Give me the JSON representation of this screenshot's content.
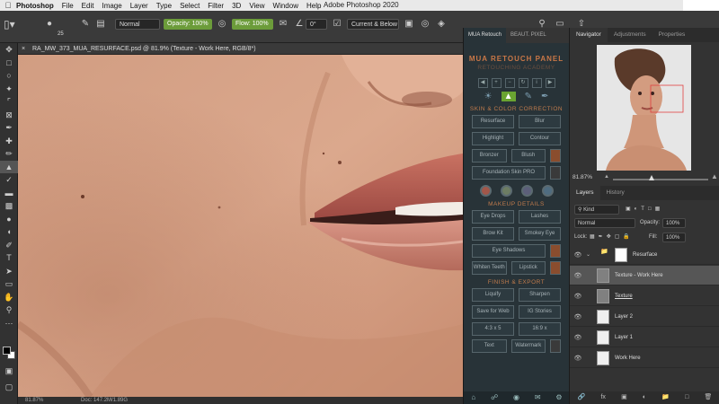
{
  "menubar": {
    "app_name": "Photoshop",
    "items": [
      "File",
      "Edit",
      "Image",
      "Layer",
      "Type",
      "Select",
      "Filter",
      "3D",
      "View",
      "Window",
      "Help"
    ],
    "window_title": "Adobe Photoshop 2020"
  },
  "options": {
    "brush_size": "25",
    "mode": "Normal",
    "opacity_label": "Opacity:",
    "opacity_value": "100%",
    "flow_label": "Flow:",
    "flow_value": "100%",
    "angle": "0°",
    "sample": "Current & Below"
  },
  "document": {
    "tab_title": "RA_MW_373_MUA_RESURFACE.psd @ 81.9% (Texture - Work Here, RGB/8*)",
    "status_zoom": "81.87%",
    "status_doc": "Doc: 147.2M/1.89G"
  },
  "mua_panel": {
    "tabs": [
      "MUA Retouch",
      "BEAUT. PIXEL"
    ],
    "title": "MUA RETOUCH PANEL",
    "subtitle": "RETOUCHING ACADEMY",
    "section_skin": "SKIN & COLOR CORRECTION",
    "skin_buttons": [
      [
        "Resurface",
        "Blur"
      ],
      [
        "Highlight",
        "Contour"
      ],
      [
        "Bronzer",
        "Blush"
      ]
    ],
    "foundation": "Foundation Skin PRO",
    "section_makeup": "MAKEUP DETAILS",
    "makeup_buttons": [
      [
        "Eye Drops",
        "Lashes"
      ],
      [
        "Brow Kit",
        "Smokey Eye"
      ]
    ],
    "eye_shadows": "Eye Shadows",
    "makeup_row3": [
      "Whiten Teeth",
      "Lipstick"
    ],
    "section_finish": "FINISH & EXPORT",
    "finish_buttons": [
      [
        "Liquify",
        "Sharpen"
      ],
      [
        "Save for Web",
        "IG Stories"
      ],
      [
        "4:3 x 5",
        "16:9 x"
      ],
      [
        "Text",
        "Watermark"
      ]
    ]
  },
  "navigator": {
    "tabs": [
      "Navigator",
      "Adjustments",
      "Properties"
    ],
    "zoom": "81.87%"
  },
  "layers": {
    "tabs": [
      "Layers",
      "History"
    ],
    "filter_kind": "Kind",
    "blend_mode": "Normal",
    "opacity_label": "Opacity:",
    "opacity_value": "100%",
    "lock_label": "Lock:",
    "fill_label": "Fill:",
    "fill_value": "100%",
    "rows": [
      {
        "name": "Resurface",
        "type": "group"
      },
      {
        "name": "Texture - Work Here",
        "type": "layer",
        "selected": true
      },
      {
        "name": "Texture",
        "type": "layer"
      },
      {
        "name": "Layer 2",
        "type": "layer"
      },
      {
        "name": "Layer 1",
        "type": "layer"
      },
      {
        "name": "Work Here",
        "type": "layer"
      }
    ]
  },
  "colors": {
    "accent_green": "#6c9c3a",
    "mua_orange": "#c97747",
    "panel_bg": "#333333"
  }
}
